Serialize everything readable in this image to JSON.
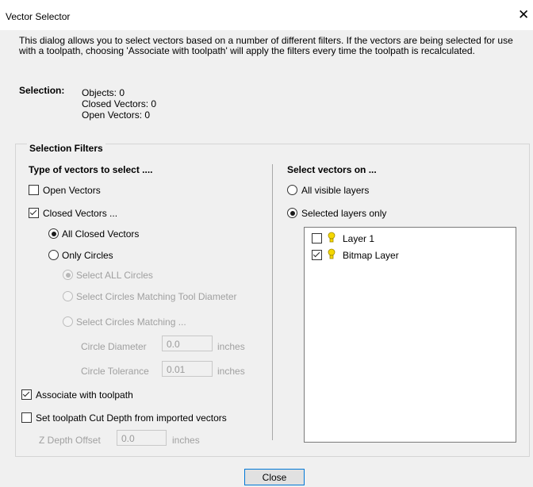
{
  "window": {
    "title": "Vector Selector"
  },
  "description": "This dialog allows you to select vectors based on a number of different filters. If the vectors are being selected for use with a toolpath, choosing 'Associate with toolpath' will apply the filters every time the toolpath is recalculated.",
  "selection": {
    "label": "Selection:",
    "objects": "Objects: 0",
    "closed": "Closed Vectors: 0",
    "open": "Open Vectors: 0"
  },
  "filters": {
    "group_label": "Selection Filters",
    "type_heading": "Type of vectors to select ....",
    "open_vectors": {
      "label": "Open Vectors",
      "checked": false
    },
    "closed_vectors": {
      "label": "Closed Vectors ...",
      "checked": true
    },
    "all_closed": {
      "label": "All Closed Vectors",
      "selected": true
    },
    "only_circles": {
      "label": "Only Circles",
      "selected": false
    },
    "select_all_circles": {
      "label": "Select ALL Circles",
      "selected": true
    },
    "circles_tool_diameter": {
      "label": "Select Circles Matching Tool Diameter"
    },
    "circles_matching": {
      "label": "Select Circles Matching ..."
    },
    "circle_diameter": {
      "label": "Circle Diameter",
      "value": "0.0",
      "unit": "inches"
    },
    "circle_tolerance": {
      "label": "Circle Tolerance",
      "value": "0.01",
      "unit": "inches"
    },
    "associate_toolpath": {
      "label": "Associate with toolpath",
      "checked": true
    },
    "set_cut_depth": {
      "label": "Set toolpath Cut Depth from imported vectors",
      "checked": false
    },
    "z_depth": {
      "label": "Z Depth Offset",
      "value": "0.0",
      "unit": "inches"
    }
  },
  "layers": {
    "heading": "Select vectors on ...",
    "all_visible": {
      "label": "All visible layers",
      "selected": false
    },
    "selected_only": {
      "label": "Selected layers only",
      "selected": true
    },
    "items": [
      {
        "label": "Layer 1",
        "checked": false,
        "icon": "lightbulb-icon"
      },
      {
        "label": "Bitmap Layer",
        "checked": true,
        "icon": "lightbulb-icon"
      }
    ]
  },
  "buttons": {
    "close": "Close"
  },
  "colors": {
    "accent": "#0078d7",
    "bulb": "#f5d800"
  }
}
